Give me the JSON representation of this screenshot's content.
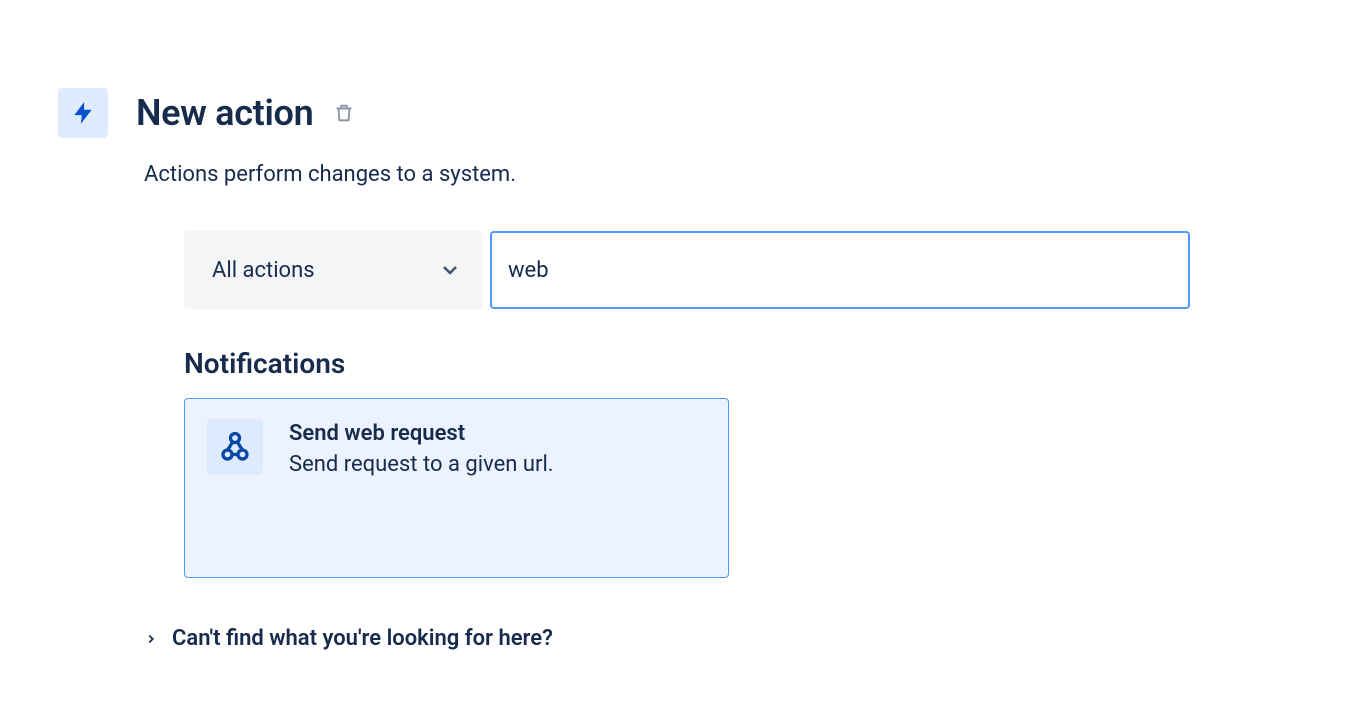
{
  "header": {
    "title": "New action"
  },
  "subtitle": "Actions perform changes to a system.",
  "filter": {
    "dropdown_label": "All actions",
    "search_value": "web"
  },
  "section": {
    "heading": "Notifications",
    "items": [
      {
        "title": "Send web request",
        "description": "Send request to a given url."
      }
    ]
  },
  "help_link": "Can't find what you're looking for here?"
}
